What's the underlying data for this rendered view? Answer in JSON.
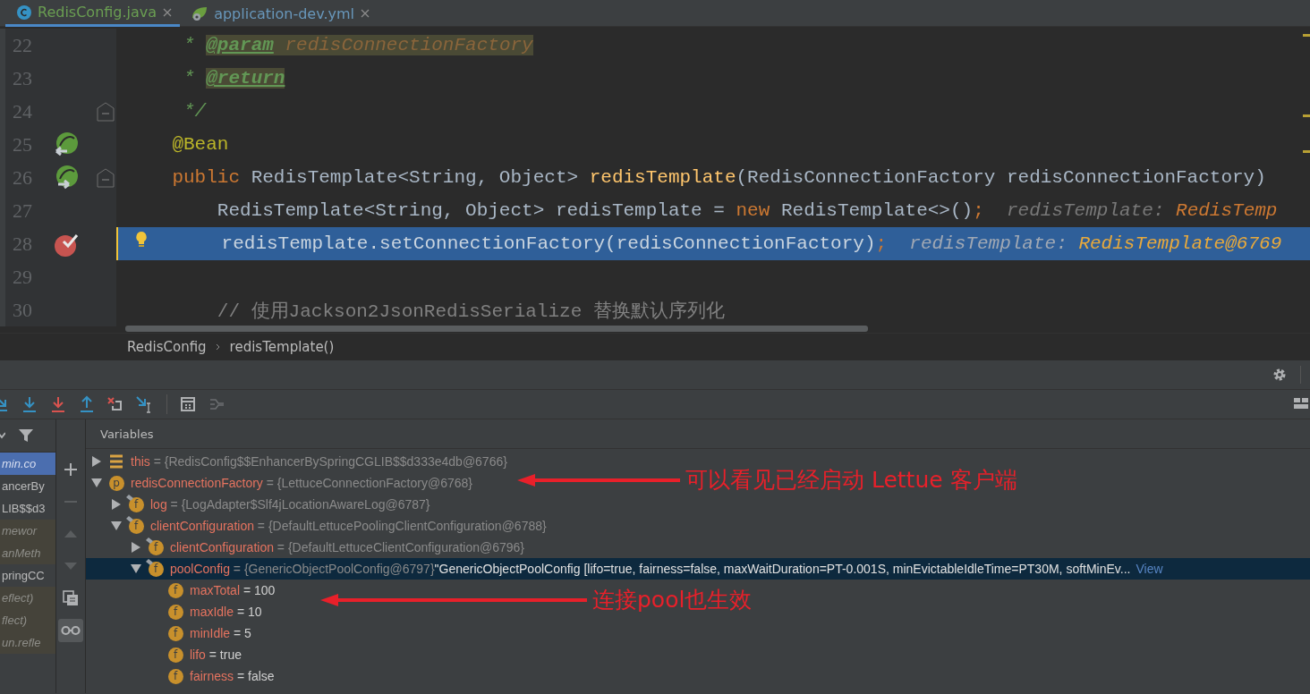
{
  "tabs": [
    {
      "label": "RedisConfig.java",
      "kind": "java",
      "selected": true
    },
    {
      "label": "application-dev.yml",
      "kind": "yml",
      "selected": false
    }
  ],
  "editor": {
    "lines": [
      {
        "number": "22",
        "kind": "plain",
        "fold": false,
        "current": false,
        "segments": [
          {
            "text": "     * ",
            "kind": "comment"
          },
          {
            "text": "@param",
            "kind": "doctag"
          },
          {
            "text": " redisConnectionFactory",
            "kind": "docparam"
          }
        ]
      },
      {
        "number": "23",
        "kind": "plain",
        "fold": false,
        "current": false,
        "segments": [
          {
            "text": "     * ",
            "kind": "comment"
          },
          {
            "text": "@return",
            "kind": "doctag"
          }
        ]
      },
      {
        "number": "24",
        "kind": "plain",
        "fold": true,
        "current": false,
        "segments": [
          {
            "text": "     */",
            "kind": "comment"
          }
        ]
      },
      {
        "number": "25",
        "kind": "bean-in",
        "fold": false,
        "current": false,
        "segments": [
          {
            "text": "    @Bean",
            "kind": "annotation"
          }
        ]
      },
      {
        "number": "26",
        "kind": "bean-out",
        "fold": true,
        "current": false,
        "segments": [
          {
            "text": "    public ",
            "kind": "keyword"
          },
          {
            "text": "RedisTemplate<String, Object> ",
            "kind": "plain"
          },
          {
            "text": "redisTemplate",
            "kind": "method"
          },
          {
            "text": "(RedisConnectionFactory redisConnectionFactory)",
            "kind": "plain"
          }
        ]
      },
      {
        "number": "27",
        "kind": "plain",
        "fold": false,
        "current": false,
        "segments": [
          {
            "text": "        RedisTemplate<String, Object> redisTemplate = ",
            "kind": "plain"
          },
          {
            "text": "new ",
            "kind": "keyword"
          },
          {
            "text": "RedisTemplate<>()",
            "kind": "plain"
          },
          {
            "text": ";",
            "kind": "keyword"
          },
          {
            "text": "  redisTemplate: ",
            "kind": "hint"
          },
          {
            "text": "RedisTemp",
            "kind": "hintvalue"
          }
        ]
      },
      {
        "number": "28",
        "kind": "breakpoint",
        "fold": false,
        "current": true,
        "segments": [
          {
            "text": "      redisTemplate.setConnectionFactory(redisConnectionFactory)",
            "kind": "plain"
          },
          {
            "text": ";",
            "kind": "keyword"
          },
          {
            "text": "  redisTemplate: ",
            "kind": "hint"
          },
          {
            "text": "RedisTemplate@6769",
            "kind": "hintvalue"
          }
        ]
      },
      {
        "number": "29",
        "kind": "plain",
        "fold": false,
        "current": false
      },
      {
        "number": "30",
        "kind": "plain",
        "fold": false,
        "current": false,
        "segments": [
          {
            "text": "        // 使用Jackson2JsonRedisSerialize 替换默认序列化",
            "kind": "linecomment"
          }
        ]
      }
    ]
  },
  "breadcrumbs": [
    "RedisConfig",
    "redisTemplate()"
  ],
  "debugger": {
    "toolbar": [
      {
        "kind": "step-over"
      },
      {
        "kind": "step-into"
      },
      {
        "kind": "force-step-into"
      },
      {
        "kind": "step-out"
      },
      {
        "kind": "drop-frame"
      },
      {
        "kind": "run-to-cursor"
      },
      {
        "kind": "evaluate"
      },
      {
        "kind": "trace"
      }
    ],
    "frames": [
      {
        "text": "min.co",
        "selected": true,
        "library": true
      },
      {
        "text": "ancerBy",
        "selected": false,
        "library": false
      },
      {
        "text": "LIB$$d3",
        "selected": false,
        "library": false
      },
      {
        "text": "mewor",
        "selected": false,
        "library": true
      },
      {
        "text": "anMeth",
        "selected": false,
        "library": true
      },
      {
        "text": "pringCC",
        "selected": false,
        "library": false
      },
      {
        "text": "eflect)",
        "selected": false,
        "library": true
      },
      {
        "text": "flect)",
        "selected": false,
        "library": true
      },
      {
        "text": "un.refle",
        "selected": false,
        "library": true
      }
    ],
    "side_buttons": [
      {
        "kind": "add",
        "disabled": false
      },
      {
        "kind": "remove",
        "disabled": true
      },
      {
        "kind": "up",
        "disabled": true
      },
      {
        "kind": "down",
        "disabled": true
      },
      {
        "kind": "copy",
        "disabled": false
      },
      {
        "kind": "watches",
        "disabled": false
      }
    ],
    "variables_title": "Variables",
    "variables": [
      {
        "kind": "this",
        "name": "this",
        "value": "= {RedisConfig$$EnhancerBySpringCGLIB$$d333e4db@6766}",
        "object": true,
        "expanded": false,
        "selected": false
      },
      {
        "kind": "param",
        "icon": "p",
        "name": "redisConnectionFactory",
        "value": "= {LettuceConnectionFactory@6768}",
        "object": true,
        "expanded": true,
        "selected": false,
        "children": [
          {
            "kind": "field",
            "icon": "f",
            "final": true,
            "name": "log",
            "value": "= {LogAdapter$Slf4jLocationAwareLog@6787}",
            "object": true,
            "expanded": false,
            "selected": false
          },
          {
            "kind": "field",
            "icon": "f",
            "final": true,
            "name": "clientConfiguration",
            "value": "= {DefaultLettucePoolingClientConfiguration@6788}",
            "object": true,
            "expanded": true,
            "selected": false,
            "children": [
              {
                "kind": "field",
                "icon": "f",
                "final": true,
                "name": "clientConfiguration",
                "value": "= {DefaultLettuceClientConfiguration@6796}",
                "object": true,
                "expanded": false,
                "selected": false
              },
              {
                "kind": "field",
                "icon": "f",
                "final": true,
                "name": "poolConfig",
                "value": "= {GenericObjectPoolConfig@6797}",
                "object": true,
                "text": "\"GenericObjectPoolConfig [lifo=true, fairness=false, maxWaitDuration=PT-0.001S, minEvictableIdleTime=PT30M, softMinEv...",
                "link": "View",
                "expanded": true,
                "selected": true,
                "children": [
                  {
                    "kind": "field",
                    "icon": "f",
                    "final": false,
                    "name": "maxTotal",
                    "value": "= 100",
                    "object": false,
                    "selected": false
                  },
                  {
                    "kind": "field",
                    "icon": "f",
                    "final": false,
                    "name": "maxIdle",
                    "value": "= 10",
                    "object": false,
                    "selected": false
                  },
                  {
                    "kind": "field",
                    "icon": "f",
                    "final": false,
                    "name": "minIdle",
                    "value": "= 5",
                    "object": false,
                    "selected": false
                  },
                  {
                    "kind": "field",
                    "icon": "f",
                    "final": false,
                    "name": "lifo",
                    "value": "= true",
                    "object": false,
                    "selected": false
                  },
                  {
                    "kind": "field",
                    "icon": "f",
                    "final": false,
                    "name": "fairness",
                    "value": "= false",
                    "object": false,
                    "selected": false
                  }
                ]
              }
            ]
          }
        ]
      }
    ],
    "annotations": [
      {
        "text": "可以看见已经启动 Lettue 客户端"
      },
      {
        "text": "连接pool也生效"
      }
    ]
  }
}
